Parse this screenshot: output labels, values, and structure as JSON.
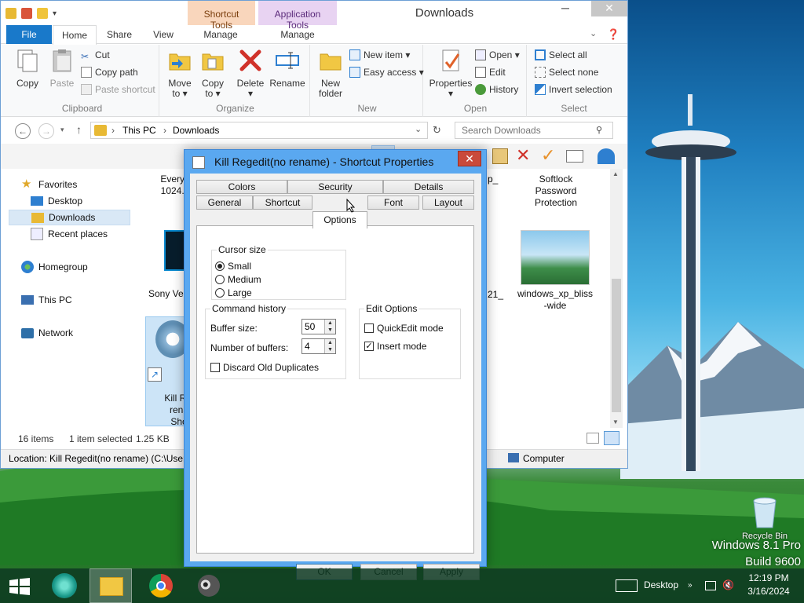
{
  "desktop": {
    "os_name": "Windows 8.1 Pro",
    "os_build": "Build 9600",
    "recycle_label": "Recycle Bin"
  },
  "explorer": {
    "title": "Downloads",
    "context_tabs": [
      "Shortcut Tools",
      "Application Tools"
    ],
    "tabs": {
      "file": "File",
      "home": "Home",
      "share": "Share",
      "view": "View",
      "manage1": "Manage",
      "manage2": "Manage"
    },
    "ribbon": {
      "clipboard": {
        "label": "Clipboard",
        "copy": "Copy",
        "paste": "Paste",
        "cut": "Cut",
        "copy_path": "Copy path",
        "paste_shortcut": "Paste shortcut"
      },
      "organize": {
        "label": "Organize",
        "move_to": "Move",
        "move_to2": "to ▾",
        "copy_to": "Copy",
        "copy_to2": "to ▾",
        "delete": "Delete",
        "delete2": "▾",
        "rename": "Rename"
      },
      "new": {
        "label": "New",
        "new_folder": "New",
        "new_folder2": "folder",
        "new_item": "New item ▾",
        "easy_access": "Easy access ▾"
      },
      "open": {
        "label": "Open",
        "properties": "Properties",
        "properties2": "▾",
        "open": "Open ▾",
        "edit": "Edit",
        "history": "History"
      },
      "select": {
        "label": "Select",
        "select_all": "Select all",
        "select_none": "Select none",
        "invert": "Invert selection"
      }
    },
    "nav": {
      "path_root": "This PC",
      "path_leaf": "Downloads",
      "search_placeholder": "Search Downloads"
    },
    "navpane": {
      "favorites": "Favorites",
      "desktop": "Desktop",
      "downloads": "Downloads",
      "recent": "Recent places",
      "homegroup": "Homegroup",
      "thispc": "This PC",
      "network": "Network"
    },
    "tiles": {
      "t1": "Everythi",
      "t1b": "1024.x6",
      "t2": "Softlock",
      "t2b": "Password",
      "t2c": "Protection",
      "t3": "Sony Veg",
      "t4": "windows_xp_bliss",
      "t4b": "-wide",
      "t5": "Kill Reg",
      "t5b": "renar",
      "t5c": "Shor",
      "t6a": "p_",
      "t6b": "21_"
    },
    "status": {
      "count": "16 items",
      "selected": "1 item selected",
      "size": "1.25 KB"
    },
    "details": {
      "location": "Location: Kill Regedit(no rename) (C:\\Users",
      "computer": "Computer"
    }
  },
  "dialog": {
    "title": "Kill Regedit(no rename) - Shortcut Properties",
    "tabs": {
      "colors": "Colors",
      "security": "Security",
      "details": "Details",
      "general": "General",
      "shortcut": "Shortcut",
      "options": "Options",
      "font": "Font",
      "layout": "Layout"
    },
    "cursor": {
      "label": "Cursor size",
      "small": "Small",
      "medium": "Medium",
      "large": "Large",
      "selected": "Small"
    },
    "history": {
      "label": "Command history",
      "buffer_size_label": "Buffer size:",
      "buffer_size": "50",
      "num_buffers_label": "Number of buffers:",
      "num_buffers": "4",
      "discard_label": "Discard Old Duplicates"
    },
    "edit": {
      "label": "Edit Options",
      "quickedit": "QuickEdit mode",
      "insert": "Insert mode"
    },
    "buttons": {
      "ok": "OK",
      "cancel": "Cancel",
      "apply": "Apply"
    }
  },
  "taskbar": {
    "desktop_label": "Desktop",
    "time": "12:19 PM",
    "date": "3/16/2024"
  }
}
